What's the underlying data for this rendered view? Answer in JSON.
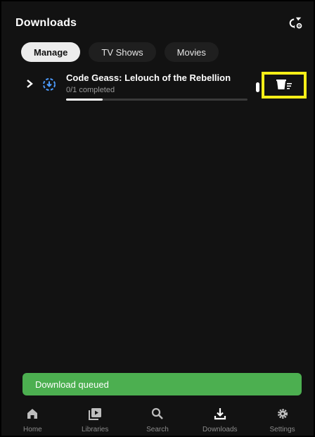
{
  "header": {
    "title": "Downloads",
    "sync_icon": "sync-settings-icon"
  },
  "tabs": [
    {
      "label": "Manage",
      "active": true
    },
    {
      "label": "TV Shows",
      "active": false
    },
    {
      "label": "Movies",
      "active": false
    }
  ],
  "downloads": [
    {
      "title": "Code Geass: Lelouch of the Rebellion",
      "status": "0/1 completed",
      "progress": 0.2,
      "status_icon": "downloading-icon",
      "delete_icon": "delete-icon"
    }
  ],
  "toast": {
    "message": "Download queued"
  },
  "bottom_nav": [
    {
      "label": "Home",
      "icon": "home-icon"
    },
    {
      "label": "Libraries",
      "icon": "libraries-icon"
    },
    {
      "label": "Search",
      "icon": "search-icon"
    },
    {
      "label": "Downloads",
      "icon": "download-icon"
    },
    {
      "label": "Settings",
      "icon": "settings-icon"
    }
  ],
  "colors": {
    "background": "#121212",
    "accent": "#4d9cff",
    "toast": "#4caf50",
    "highlight": "#f5ee18"
  }
}
